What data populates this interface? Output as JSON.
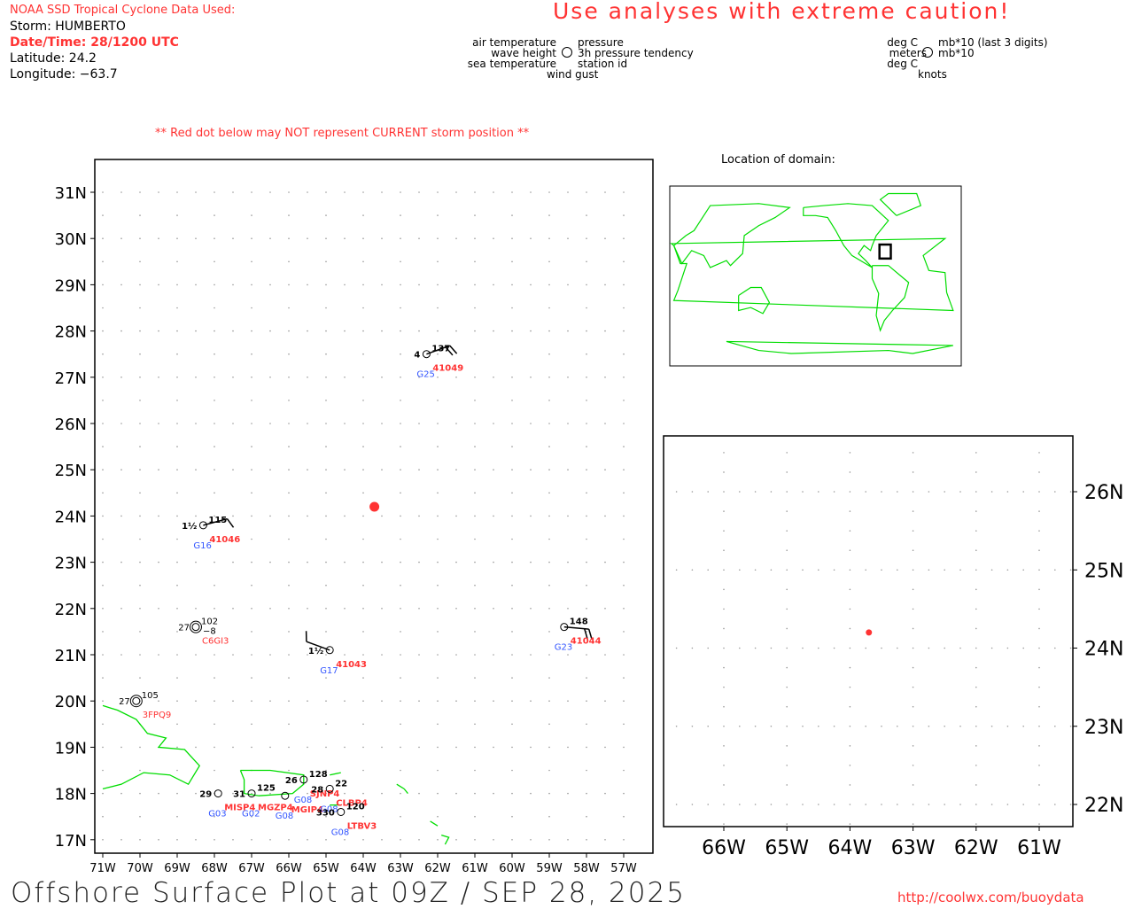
{
  "header": {
    "source": "NOAA SSD Tropical Cyclone Data Used:",
    "storm": "Storm: HUMBERTO",
    "datetime": "Date/Time: 28/1200 UTC",
    "latitude": "Latitude: 24.2",
    "longitude": "Longitude: −63.7",
    "caution": "Use analyses with extreme caution!",
    "red_dot_note": "** Red dot below may NOT represent CURRENT storm position **"
  },
  "legend": {
    "left": {
      "tl": "air temperature",
      "ml": "wave height",
      "bl": "sea temperature",
      "tr": "pressure",
      "mr": "3h pressure tendency",
      "br": "station id",
      "bottom": "wind gust"
    },
    "right": {
      "tl": "deg C",
      "ml": "meters",
      "bl": "deg C",
      "tr": "mb*10 (last 3 digits)",
      "mr": "mb*10",
      "bottom": "knots"
    }
  },
  "inset_title": "Location of domain:",
  "footer": {
    "title": "Offshore Surface Plot at 09Z / SEP 28, 2025",
    "url": "http://coolwx.com/buoydata"
  },
  "main_map": {
    "lon_ticks": [
      "71W",
      "70W",
      "69W",
      "68W",
      "67W",
      "66W",
      "65W",
      "64W",
      "63W",
      "62W",
      "61W",
      "60W",
      "59W",
      "58W",
      "57W"
    ],
    "lat_ticks": [
      "31N",
      "30N",
      "29N",
      "28N",
      "27N",
      "26N",
      "25N",
      "24N",
      "23N",
      "22N",
      "21N",
      "20N",
      "19N",
      "18N",
      "17N"
    ]
  },
  "zoom_map": {
    "lon_ticks": [
      "66W",
      "65W",
      "64W",
      "63W",
      "62W",
      "61W"
    ],
    "lat_ticks": [
      "26N",
      "25N",
      "24N",
      "23N",
      "22N"
    ]
  },
  "storm": {
    "lat": 24.2,
    "lon": -63.7,
    "color": "#ff3333"
  },
  "colors": {
    "coast": "#00dd00",
    "station_id": "#ff3333",
    "goes": "#3355ff",
    "grid": "#999999"
  },
  "stations": [
    {
      "id": "41049",
      "lat": 27.5,
      "lon": -62.3,
      "left": "4",
      "pressure": "137",
      "goes": "G25",
      "wind_dir": 70,
      "wind_kt": 20
    },
    {
      "id": "41046",
      "lat": 23.8,
      "lon": -68.3,
      "left": "1½",
      "pressure": "115",
      "goes": "G16",
      "wind_dir": 75,
      "wind_kt": 10
    },
    {
      "id": "C6GI3",
      "lat": 21.6,
      "lon": -68.5,
      "left": "27",
      "pressure": "102",
      "tendency": "−8",
      "goes": "",
      "ship": true
    },
    {
      "id": "41043",
      "lat": 21.1,
      "lon": -64.9,
      "left": "1½",
      "pressure": "",
      "goes": "G17",
      "wind_dir": 290,
      "wind_kt": 10
    },
    {
      "id": "3FPQ9",
      "lat": 20.0,
      "lon": -70.1,
      "left": "27",
      "pressure": "105",
      "goes": "",
      "ship": true
    },
    {
      "id": "41044",
      "lat": 21.6,
      "lon": -58.6,
      "left": "",
      "pressure": "148",
      "goes": "G23",
      "wind_dir": 95,
      "wind_kt": 20
    },
    {
      "id": "MISP4",
      "lat": 18.0,
      "lon": -67.9,
      "left": "29",
      "pressure": "",
      "goes": "G03"
    },
    {
      "id": "MGZP4",
      "lat": 18.0,
      "lon": -67.0,
      "left": "31",
      "pressure": "125",
      "goes": "G02"
    },
    {
      "id": "MGIP4",
      "lat": 17.95,
      "lon": -66.1,
      "left": "",
      "pressure": "",
      "goes": "G08"
    },
    {
      "id": "SJNP4",
      "lat": 18.3,
      "lon": -65.6,
      "left": "26",
      "pressure": "128",
      "goes": "G08"
    },
    {
      "id": "CLBP4",
      "lat": 18.1,
      "lon": -64.9,
      "left": "28",
      "pressure": "22",
      "goes": "G08"
    },
    {
      "id": "LTBV3",
      "lat": 17.6,
      "lon": -64.6,
      "left": "330",
      "pressure": "120",
      "goes": "G08"
    }
  ]
}
